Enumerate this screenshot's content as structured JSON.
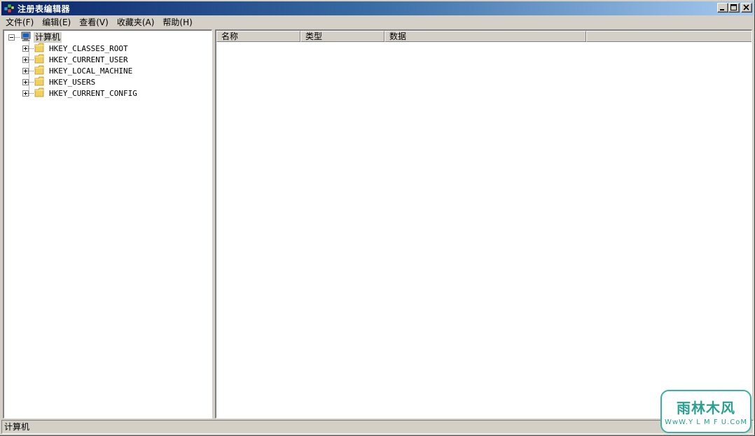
{
  "window": {
    "title": "注册表编辑器"
  },
  "menubar": {
    "items": [
      {
        "label": "文件(F)"
      },
      {
        "label": "编辑(E)"
      },
      {
        "label": "查看(V)"
      },
      {
        "label": "收藏夹(A)"
      },
      {
        "label": "帮助(H)"
      }
    ]
  },
  "tree": {
    "root": {
      "label": "计算机",
      "icon": "computer-icon",
      "expanded": true
    },
    "children": [
      {
        "label": "HKEY_CLASSES_ROOT",
        "icon": "folder-icon"
      },
      {
        "label": "HKEY_CURRENT_USER",
        "icon": "folder-icon"
      },
      {
        "label": "HKEY_LOCAL_MACHINE",
        "icon": "folder-icon"
      },
      {
        "label": "HKEY_USERS",
        "icon": "folder-icon"
      },
      {
        "label": "HKEY_CURRENT_CONFIG",
        "icon": "folder-icon"
      }
    ]
  },
  "list": {
    "columns": [
      {
        "label": "名称"
      },
      {
        "label": "类型"
      },
      {
        "label": "数据"
      }
    ]
  },
  "statusbar": {
    "text": "计算机"
  },
  "watermark": {
    "main": "雨林木风",
    "sub": "WwW.Y L M F U.CoM"
  },
  "colors": {
    "title_start": "#0a246a",
    "title_end": "#a6caf0",
    "chrome": "#d4d0c8",
    "watermark": "#2aa090"
  }
}
